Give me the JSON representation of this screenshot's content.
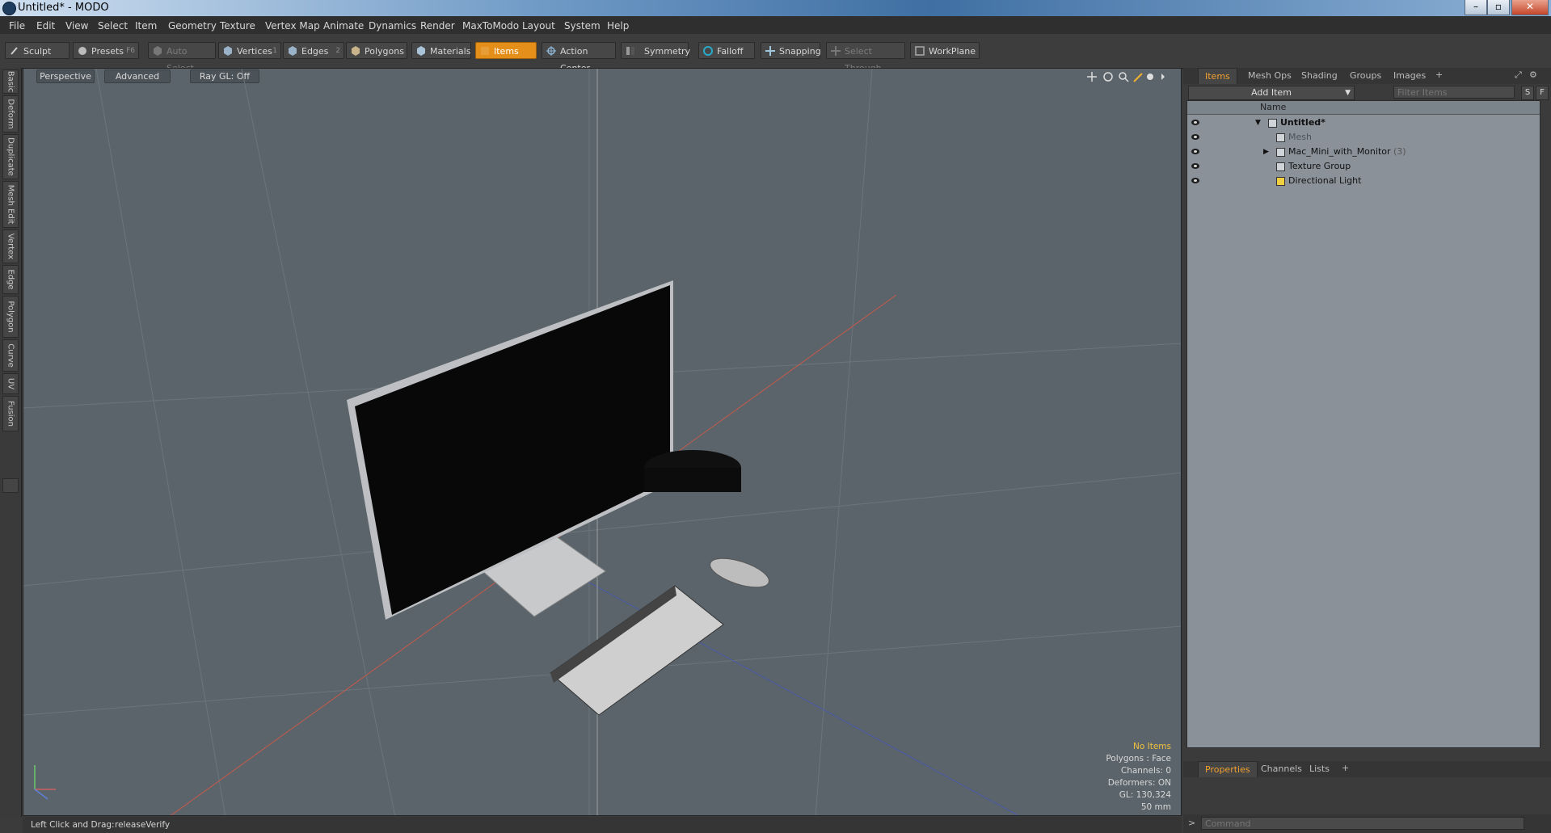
{
  "window": {
    "title": "Untitled* - MODO"
  },
  "menu": [
    "File",
    "Edit",
    "View",
    "Select",
    "Item",
    "Geometry",
    "Texture",
    "Vertex Map",
    "Animate",
    "Dynamics",
    "Render",
    "MaxToModo",
    "Layout",
    "System",
    "Help"
  ],
  "toolbar": {
    "sculpt": "Sculpt",
    "presets": "Presets",
    "presets_key": "F6",
    "auto_select": "Auto Select",
    "vertices": "Vertices",
    "vertices_key": "1",
    "edges": "Edges",
    "edges_key": "2",
    "polygons": "Polygons",
    "materials": "Materials",
    "items": "Items",
    "action_center": "Action Center",
    "symmetry": "Symmetry",
    "falloff": "Falloff",
    "snapping": "Snapping",
    "select_through": "Select Through",
    "workplane": "WorkPlane"
  },
  "left_tabs": [
    "Basic",
    "Deform",
    "Duplicate",
    "Mesh Edit",
    "Vertex",
    "Edge",
    "Polygon",
    "Curve",
    "UV",
    "Fusion"
  ],
  "viewport": {
    "view_mode": "Perspective",
    "shading": "Advanced",
    "raygl": "Ray GL: Off",
    "stats": {
      "selection": "No Items",
      "polygons": "Polygons : Face",
      "channels": "Channels: 0",
      "deformers": "Deformers: ON",
      "gl": "GL: 130,324",
      "scale": "50 mm"
    }
  },
  "status": {
    "hint": "Left Click and Drag:",
    "value": "releaseVerify"
  },
  "right_panel": {
    "tabs": [
      "Items",
      "Mesh Ops",
      "Shading",
      "Groups",
      "Images"
    ],
    "add_item": "Add Item",
    "filter_placeholder": "Filter Items",
    "column_name": "Name",
    "items": [
      {
        "label": "Untitled*",
        "count": ""
      },
      {
        "label": "Mesh",
        "count": ""
      },
      {
        "label": "Mac_Mini_with_Monitor",
        "count": "(3)"
      },
      {
        "label": "Texture Group",
        "count": ""
      },
      {
        "label": "Directional Light",
        "count": ""
      }
    ],
    "bottom_tabs": [
      "Properties",
      "Channels",
      "Lists"
    ],
    "command_placeholder": "Command"
  },
  "colors": {
    "accent": "#e48f1a",
    "viewport_bg": "#5a646a",
    "stats_highlight": "#f0c040"
  }
}
